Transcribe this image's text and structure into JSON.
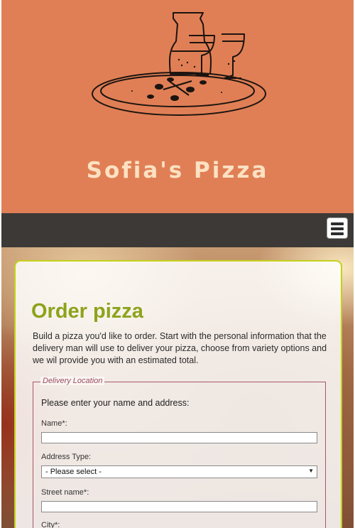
{
  "site": {
    "title": "Sofia's Pizza",
    "logo": "pizza-and-wine-illustration"
  },
  "nav": {
    "menu_icon": "hamburger-menu-icon"
  },
  "main": {
    "title": "Order pizza",
    "intro": "Build a pizza you'd like to order. Start with the personal information that the delivery man will use to deliver your pizza, choose from variety options and we wil provide you with an estimated total."
  },
  "delivery": {
    "legend": "Delivery Location",
    "prompt": "Please enter your name and address:",
    "name_label": "Name*:",
    "name_value": "",
    "address_type_label": "Address Type:",
    "address_type_selected": "- Please select -",
    "street_label": "Street name*:",
    "street_value": "",
    "city_label": "City*:"
  },
  "colors": {
    "header_bg": "#e07f55",
    "title_text": "#fce1c2",
    "nav_bg": "#3d3937",
    "accent_green": "#8da31b",
    "card_border": "#c5d11a",
    "legend_color": "#9a4b62"
  }
}
